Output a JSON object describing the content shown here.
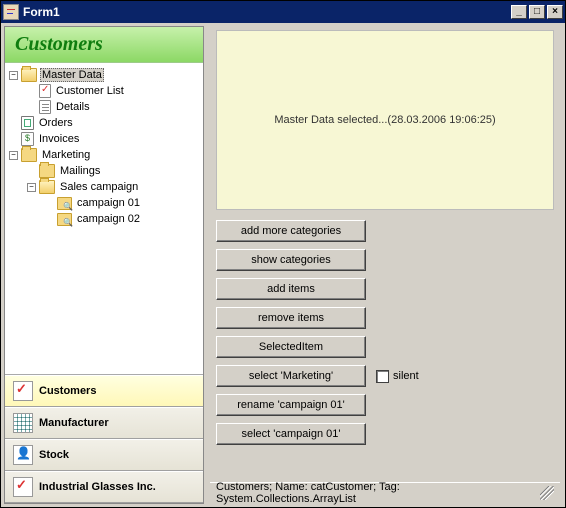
{
  "window": {
    "title": "Form1",
    "minimize": "_",
    "maximize": "□",
    "close": "×"
  },
  "nav_header": "Customers",
  "tree": {
    "master_data": {
      "label": "Master Data",
      "expanded": true,
      "selected": true
    },
    "customer_list": {
      "label": "Customer List"
    },
    "details": {
      "label": "Details"
    },
    "orders": {
      "label": "Orders"
    },
    "invoices": {
      "label": "Invoices"
    },
    "marketing": {
      "label": "Marketing",
      "expanded": true
    },
    "mailings": {
      "label": "Mailings"
    },
    "sales_campaign": {
      "label": "Sales campaign",
      "expanded": true
    },
    "campaign_01": {
      "label": "campaign 01"
    },
    "campaign_02": {
      "label": "campaign 02"
    }
  },
  "sections": {
    "customers": "Customers",
    "manufacturer": "Manufacturer",
    "stock": "Stock",
    "industrial": "Industrial Glasses Inc."
  },
  "note": "Master Data selected...(28.03.2006 19:06:25)",
  "buttons": {
    "add_more_categories": "add more categories",
    "show_categories": "show categories",
    "add_items": "add items",
    "remove_items": "remove items",
    "selected_item": "SelectedItem",
    "select_marketing": "select 'Marketing'",
    "rename_campaign_01": "rename 'campaign 01'",
    "select_campaign_01": "select 'campaign 01'"
  },
  "silent": {
    "label": "silent",
    "checked": false
  },
  "statusbar": "Customers; Name: catCustomer; Tag: System.Collections.ArrayList"
}
